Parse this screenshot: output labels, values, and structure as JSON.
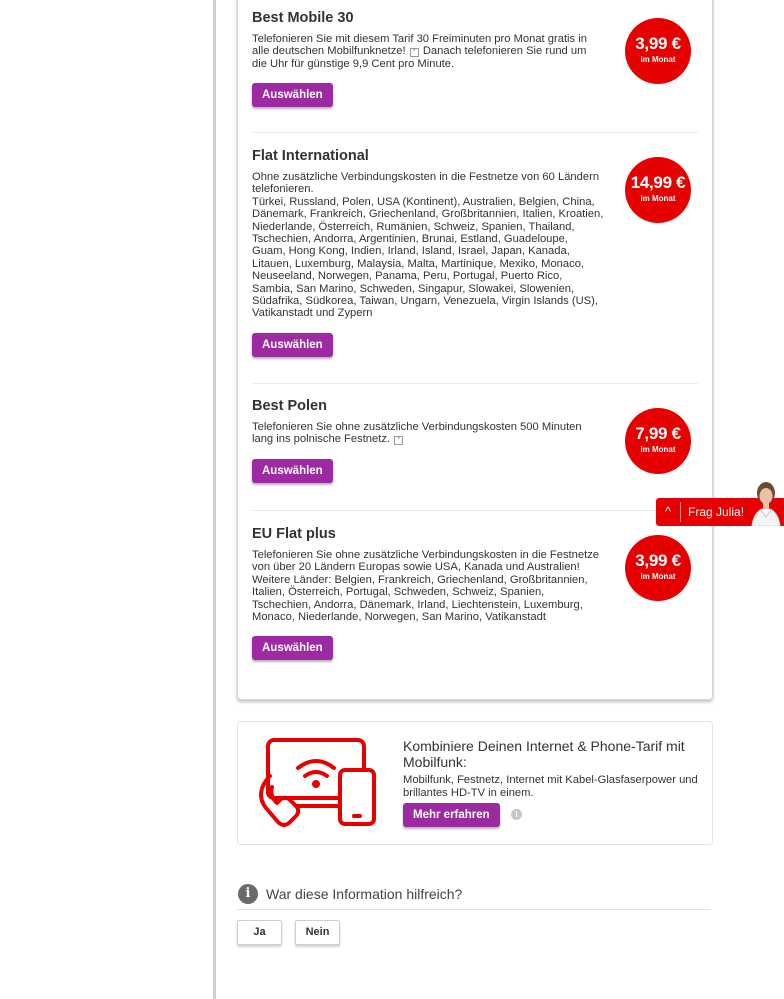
{
  "tariffs": [
    {
      "title": "Best Mobile 30",
      "desc_a": "Telefonieren Sie mit diesem Tarif 30 Freiminuten pro Monat gratis in alle deutschen Mobilfunknetze!",
      "desc_b": "Danach telefonieren Sie rund um die Uhr für günstige 9,9 Cent pro Minute.",
      "price": "3,99 €",
      "period": "im Monat",
      "button": "Auswählen"
    },
    {
      "title": "Flat International",
      "desc_a": "Ohne zusätzliche Verbindungskosten in die Festnetze von 60 Ländern telefonieren.",
      "desc_b": "Türkei, Russland, Polen, USA (Kontinent), Australien, Belgien, China, Dänemark, Frankreich, Griechenland, Großbritannien, Italien, Kroatien, Niederlande, Österreich, Rumänien, Schweiz, Spanien, Thailand, Tschechien, Andorra, Argentinien, Brunai, Estland, Guadeloupe, Guam, Hong Kong, Indien, Irland, Island, Israel, Japan, Kanada, Litauen, Luxemburg, Malaysia, Malta, Martinique, Mexiko, Monaco, Neuseeland, Norwegen, Panama, Peru, Portugal, Puerto Rico, Sambia, San Marino, Schweden, Singapur, Slowakei, Slowenien, Südafrika, Südkorea, Taiwan, Ungarn, Venezuela, Virgin Islands (US), Vatikanstadt und Zypern",
      "price": "14,99 €",
      "period": "im Monat",
      "button": "Auswählen"
    },
    {
      "title": "Best Polen",
      "desc_a": "Telefonieren Sie ohne zusätzliche Verbindungskosten 500 Minuten lang ins polnische Festnetz.",
      "price": "7,99 €",
      "period": "im Monat",
      "button": "Auswählen"
    },
    {
      "title": "EU Flat plus",
      "desc_a": "Telefonieren Sie ohne zusätzliche Verbindungskosten in die Festnetze von über 20 Ländern Europas sowie USA, Kanada und Australien!",
      "desc_b": "Weitere Länder: Belgien, Frankreich, Griechenland, Großbritannien, Italien, Österreich, Portugal, Schweden, Schweiz, Spanien, Tschechien, Andorra, Dänemark, Irland, Liechtenstein, Luxemburg, Monaco, Niederlande, Norwegen, San Marino, Vatikanstadt",
      "price": "3,99 €",
      "period": "im Monat",
      "button": "Auswählen"
    }
  ],
  "info_glyph": "*",
  "promo": {
    "title": "Kombiniere Deinen Internet & Phone-Tarif mit Mobilfunk:",
    "text": "Mobilfunk, Festnetz, Internet mit Kabel-Glasfaserpower und brillantes HD-TV in einem.",
    "button": "Mehr erfahren",
    "info": "i",
    "illustration_icon": "devices-wifi-icon"
  },
  "feedback": {
    "icon_glyph": "i",
    "question": "War diese Information hilfreich?",
    "yes": "Ja",
    "no": "Nein"
  },
  "chat": {
    "label": "Frag Julia!",
    "chevron": "^"
  },
  "colors": {
    "brand_red": "#e60000",
    "button_purple": "#9c2aa0"
  }
}
